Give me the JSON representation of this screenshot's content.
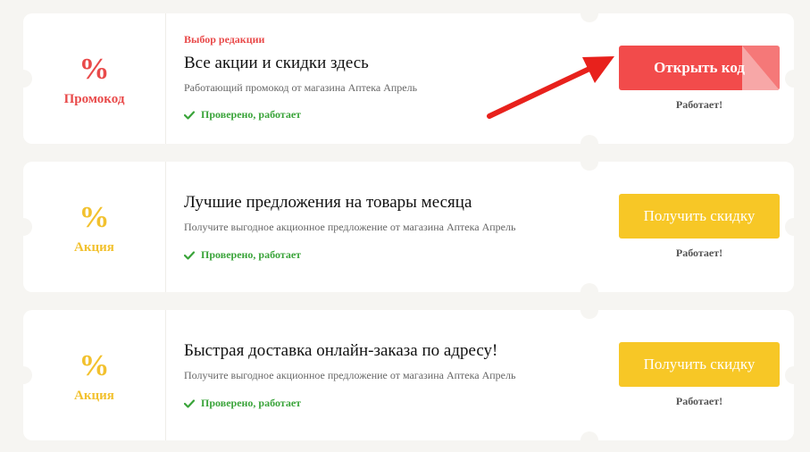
{
  "coupons": [
    {
      "symbol": "%",
      "type_label": "Промокод",
      "tag": "Выбор редакции",
      "title": "Все акции и скидки здесь",
      "description": "Работающий промокод от магазина Аптека Апрель",
      "verified": "Проверено, работает",
      "button_label": "Открыть код",
      "status": "Работает!"
    },
    {
      "symbol": "%",
      "type_label": "Акция",
      "title": "Лучшие предложения на товары месяца",
      "description": "Получите выгодное акционное предложение от магазина Аптека Апрель",
      "verified": "Проверено, работает",
      "button_label": "Получить скидку",
      "status": "Работает!"
    },
    {
      "symbol": "%",
      "type_label": "Акция",
      "title": "Быстрая доставка онлайн-заказа по адресу!",
      "description": "Получите выгодное акционное предложение от магазина Аптека Апрель",
      "verified": "Проверено, работает",
      "button_label": "Получить скидку",
      "status": "Работает!"
    }
  ],
  "colors": {
    "promo_red": "#e94a4a",
    "deal_yellow": "#f2c12e",
    "verified_green": "#3aa43a",
    "background": "#f6f5f2"
  },
  "icons": [
    "checkmark-icon",
    "red-arrow-annotation"
  ]
}
